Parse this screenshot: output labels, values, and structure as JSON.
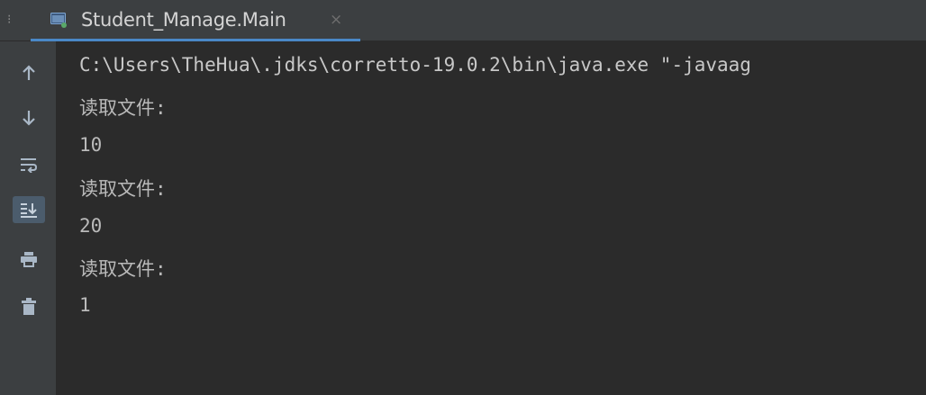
{
  "tab": {
    "title": "Student_Manage.Main",
    "close": "×"
  },
  "toolbar": {
    "items": [
      {
        "icon": "arrow-up-icon"
      },
      {
        "icon": "arrow-down-icon"
      },
      {
        "icon": "soft-wrap-icon"
      },
      {
        "icon": "scroll-to-end-icon"
      },
      {
        "icon": "print-icon"
      },
      {
        "icon": "trash-icon"
      }
    ]
  },
  "console": {
    "lines": [
      "C:\\Users\\TheHua\\.jdks\\corretto-19.0.2\\bin\\java.exe \"-javaag",
      "读取文件:",
      "10",
      "读取文件:",
      "20",
      "读取文件:",
      "1"
    ]
  },
  "colors": {
    "background": "#2b2b2b",
    "panel": "#3c3f41",
    "accent": "#4a88c7",
    "text": "#bababa"
  }
}
